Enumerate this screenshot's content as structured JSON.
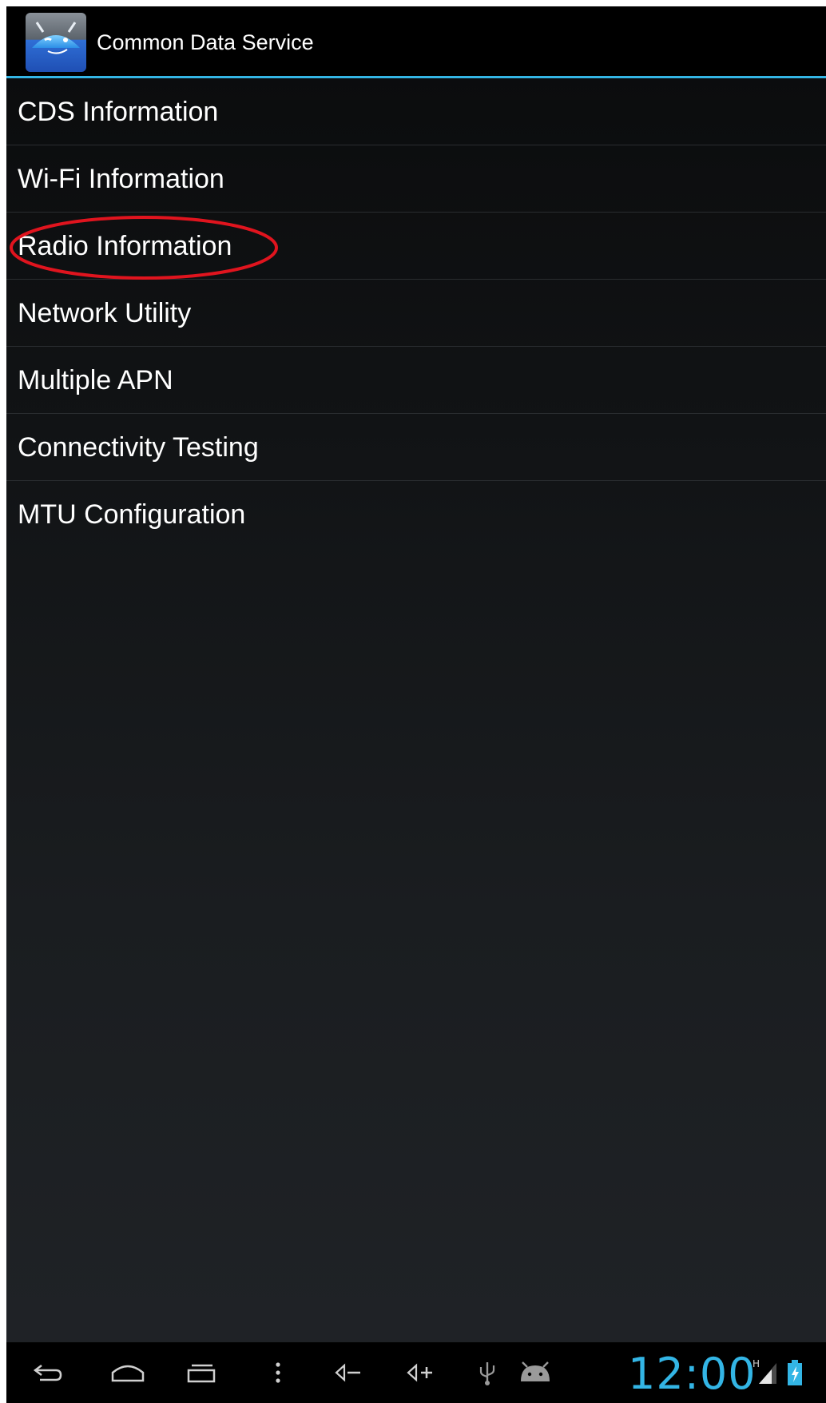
{
  "action_bar": {
    "title": "Common Data Service",
    "icon": "android-app-icon"
  },
  "menu": {
    "items": [
      {
        "label": "CDS Information"
      },
      {
        "label": "Wi-Fi Information"
      },
      {
        "label": "Radio Information",
        "highlighted": true
      },
      {
        "label": "Network Utility"
      },
      {
        "label": "Multiple APN"
      },
      {
        "label": "Connectivity Testing"
      },
      {
        "label": "MTU Configuration"
      }
    ]
  },
  "annotation": {
    "shape": "ellipse",
    "color": "#e0141e",
    "target": "Radio Information"
  },
  "nav_bar": {
    "buttons": [
      "back-icon",
      "home-icon",
      "recent-apps-icon",
      "menu-icon",
      "volume-down-icon",
      "volume-up-icon"
    ],
    "status_icons": [
      "usb-icon",
      "android-debug-icon",
      "signal-h-icon",
      "battery-charging-icon"
    ],
    "clock": "12:00",
    "network_type": "H"
  },
  "colors": {
    "accent": "#33b5e5",
    "action_bar_bg": "#000000",
    "text": "#ffffff"
  }
}
